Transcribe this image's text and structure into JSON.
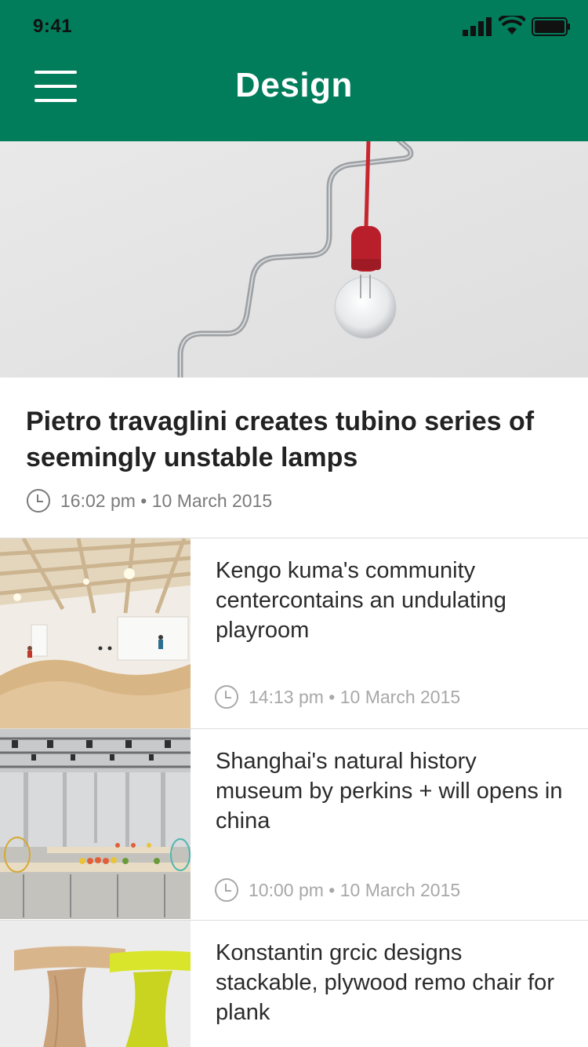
{
  "status": {
    "time": "9:41"
  },
  "header": {
    "title": "Design"
  },
  "hero": {
    "title": "Pietro travaglini creates tubino series of seemingly unstable lamps",
    "time": "16:02 pm",
    "date": "10 March 2015"
  },
  "articles": [
    {
      "title": "Kengo kuma's community centercontains an undulating playroom",
      "time": "14:13 pm",
      "date": "10 March 2015"
    },
    {
      "title": "Shanghai's natural history museum by perkins + will opens in china",
      "time": "10:00 pm",
      "date": "10 March 2015"
    },
    {
      "title": "Konstantin grcic designs stackable, plywood remo chair for plank",
      "time": "",
      "date": ""
    }
  ],
  "colors": {
    "header": "#017d5b",
    "lamp": "#c8262f",
    "chair_yellow": "#d9e52a"
  }
}
